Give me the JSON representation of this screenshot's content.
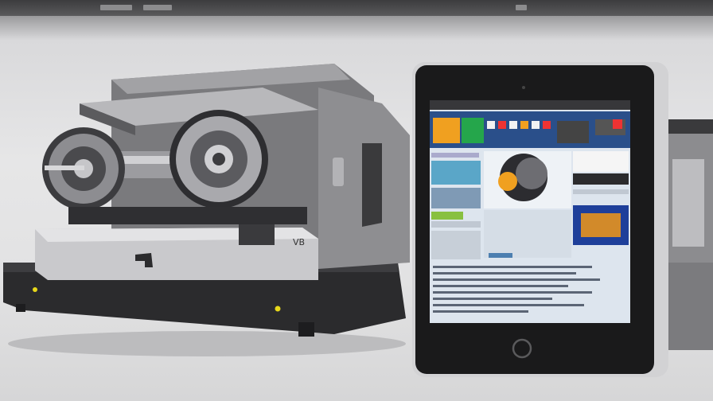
{
  "scene": {
    "type": "photo-illustration",
    "subjects": [
      "cnc-lathe-machine",
      "tablet-control-panel",
      "machine-housing-edge"
    ],
    "colors": {
      "background": "#e4e4e5",
      "machine_body": "#8a8a8c",
      "machine_base": "#2a2a2c",
      "tablet_frame": "#1a1a1a",
      "screen_bg": "#dfe6ee",
      "accent_yellow": "#e8d81a",
      "accent_blue": "#2a4f8a"
    }
  }
}
